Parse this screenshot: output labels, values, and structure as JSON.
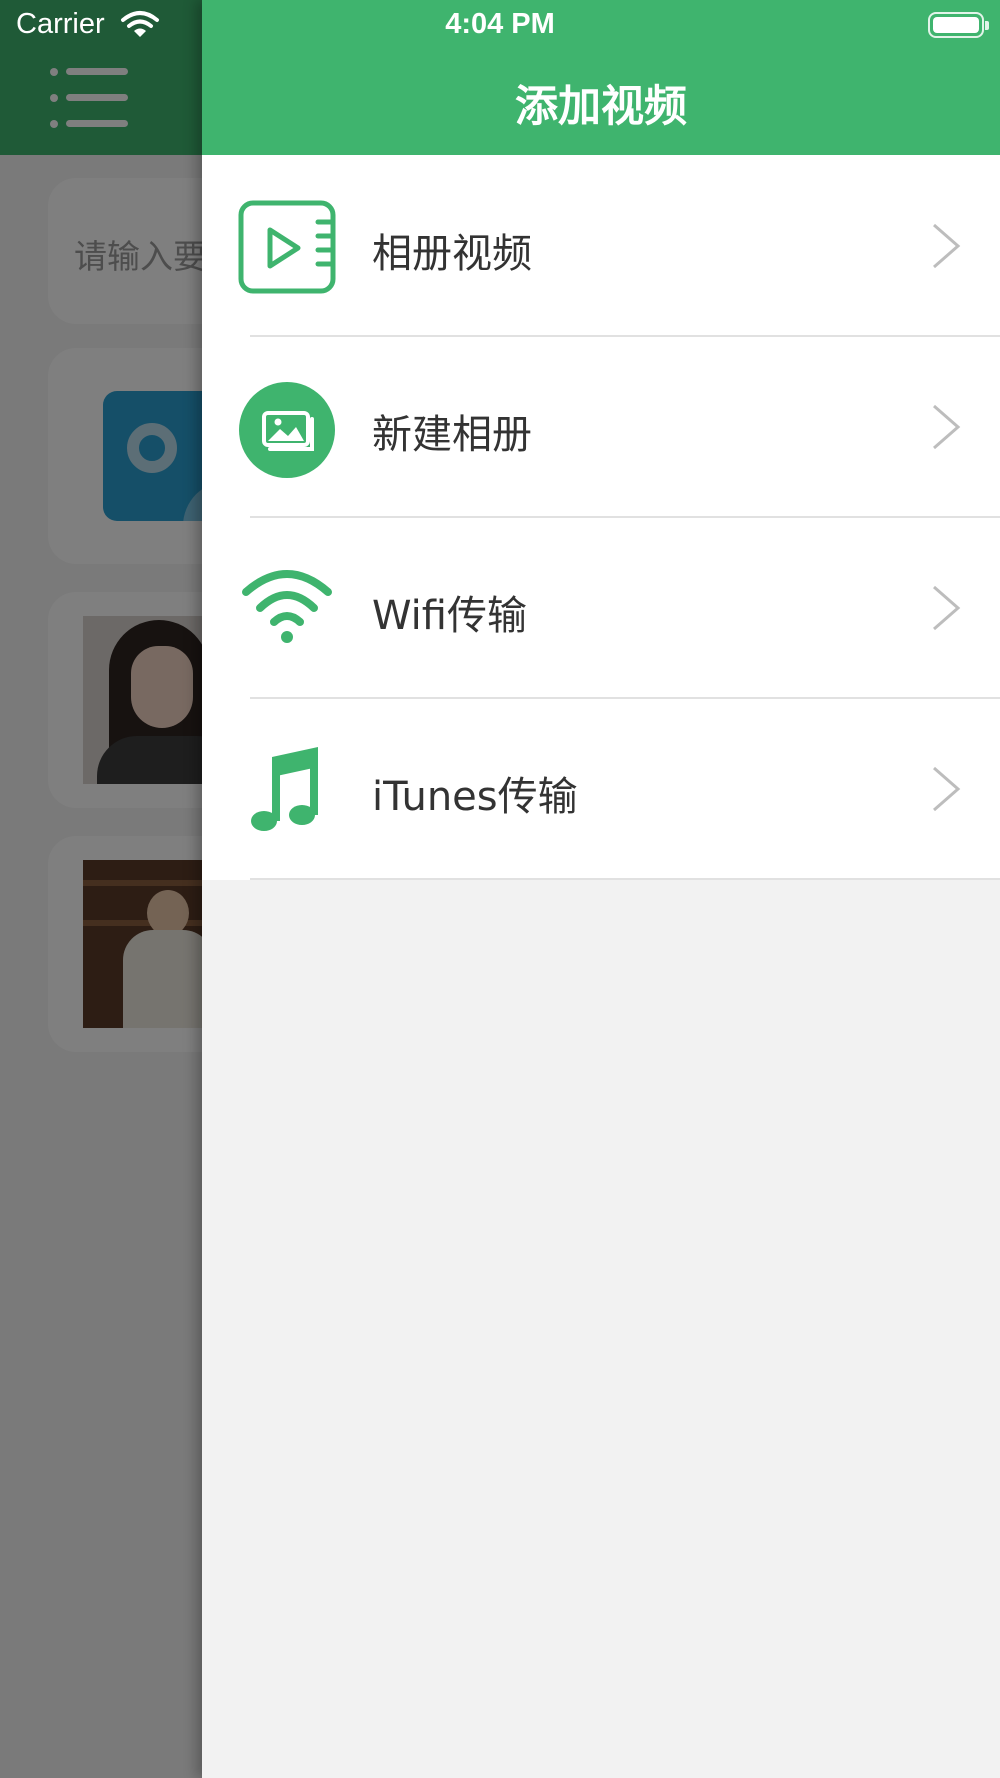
{
  "status_bar": {
    "carrier": "Carrier",
    "time": "4:04 PM"
  },
  "background": {
    "search_placeholder": "请输入要",
    "header_color": "#3fb46e"
  },
  "drawer": {
    "title": "添加视频",
    "items": [
      {
        "label": "相册视频",
        "icon": "album-video-icon"
      },
      {
        "label": "新建相册",
        "icon": "new-album-icon"
      },
      {
        "label": "Wifi传输",
        "icon": "wifi-icon"
      },
      {
        "label": "iTunes传输",
        "icon": "music-note-icon"
      }
    ]
  },
  "colors": {
    "accent": "#3fb46e",
    "chevron": "#bdbdbd",
    "text": "#333333"
  }
}
